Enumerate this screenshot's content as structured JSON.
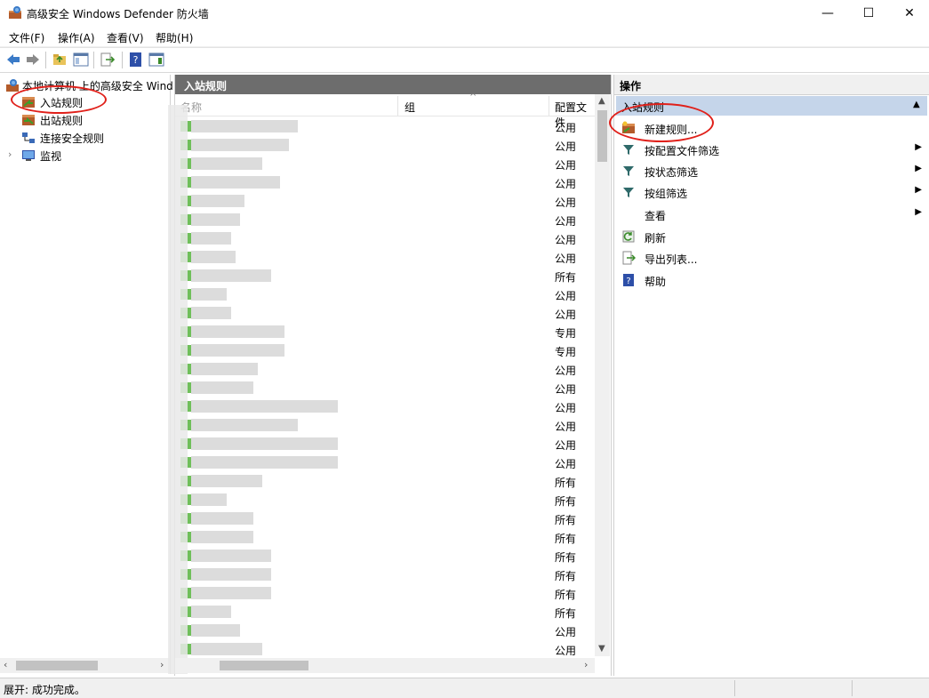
{
  "window": {
    "title": "高级安全 Windows Defender 防火墙",
    "minimize_glyph": "—",
    "maximize_glyph": "☐",
    "close_glyph": "✕"
  },
  "menu": {
    "items": [
      {
        "label": "文件(F)"
      },
      {
        "label": "操作(A)"
      },
      {
        "label": "查看(V)"
      },
      {
        "label": "帮助(H)"
      }
    ]
  },
  "tree": {
    "root": "本地计算机 上的高级安全 Wind",
    "items": [
      {
        "label": "入站规则"
      },
      {
        "label": "出站规则"
      },
      {
        "label": "连接安全规则"
      },
      {
        "label": "监视"
      }
    ]
  },
  "middle": {
    "header": "入站规则",
    "columns": {
      "name": "名称",
      "group": "组",
      "profile": "配置文件"
    },
    "rows": [
      {
        "profile": "公用",
        "w": 120
      },
      {
        "profile": "公用",
        "w": 110
      },
      {
        "profile": "公用",
        "w": 80
      },
      {
        "profile": "公用",
        "w": 100
      },
      {
        "profile": "公用",
        "w": 60
      },
      {
        "profile": "公用",
        "w": 55
      },
      {
        "profile": "公用",
        "w": 45
      },
      {
        "profile": "公用",
        "w": 50
      },
      {
        "profile": "所有",
        "w": 90
      },
      {
        "profile": "公用",
        "w": 40
      },
      {
        "profile": "公用",
        "w": 45
      },
      {
        "profile": "专用",
        "w": 105
      },
      {
        "profile": "专用",
        "w": 105
      },
      {
        "profile": "公用",
        "w": 75
      },
      {
        "profile": "公用",
        "w": 70
      },
      {
        "profile": "公用",
        "w": 165
      },
      {
        "profile": "公用",
        "w": 120
      },
      {
        "profile": "公用",
        "w": 165
      },
      {
        "profile": "公用",
        "w": 165
      },
      {
        "profile": "所有",
        "w": 80
      },
      {
        "profile": "所有",
        "w": 40
      },
      {
        "profile": "所有",
        "w": 70
      },
      {
        "profile": "所有",
        "w": 70
      },
      {
        "profile": "所有",
        "w": 90
      },
      {
        "profile": "所有",
        "w": 90
      },
      {
        "profile": "所有",
        "w": 90
      },
      {
        "profile": "所有",
        "w": 45
      },
      {
        "profile": "公用",
        "w": 55
      },
      {
        "profile": "公用",
        "w": 80
      }
    ]
  },
  "actions": {
    "header": "操作",
    "section": "入站规则",
    "items": [
      {
        "label": "新建规则...",
        "icon": "new-rule-icon",
        "arrow": false
      },
      {
        "label": "按配置文件筛选",
        "icon": "filter-icon",
        "arrow": true
      },
      {
        "label": "按状态筛选",
        "icon": "filter-icon",
        "arrow": true
      },
      {
        "label": "按组筛选",
        "icon": "filter-icon",
        "arrow": true
      },
      {
        "label": "查看",
        "icon": "",
        "arrow": true
      },
      {
        "label": "刷新",
        "icon": "refresh-icon",
        "arrow": false
      },
      {
        "label": "导出列表...",
        "icon": "export-icon",
        "arrow": false
      },
      {
        "label": "帮助",
        "icon": "help-icon",
        "arrow": false
      }
    ]
  },
  "status": {
    "text": "展开: 成功完成。"
  },
  "colors": {
    "accent_section": "#c5d5ea",
    "header_dark": "#6d6d6d",
    "annotation_red": "#e0201a",
    "rule_green": "#6fbf5a"
  }
}
